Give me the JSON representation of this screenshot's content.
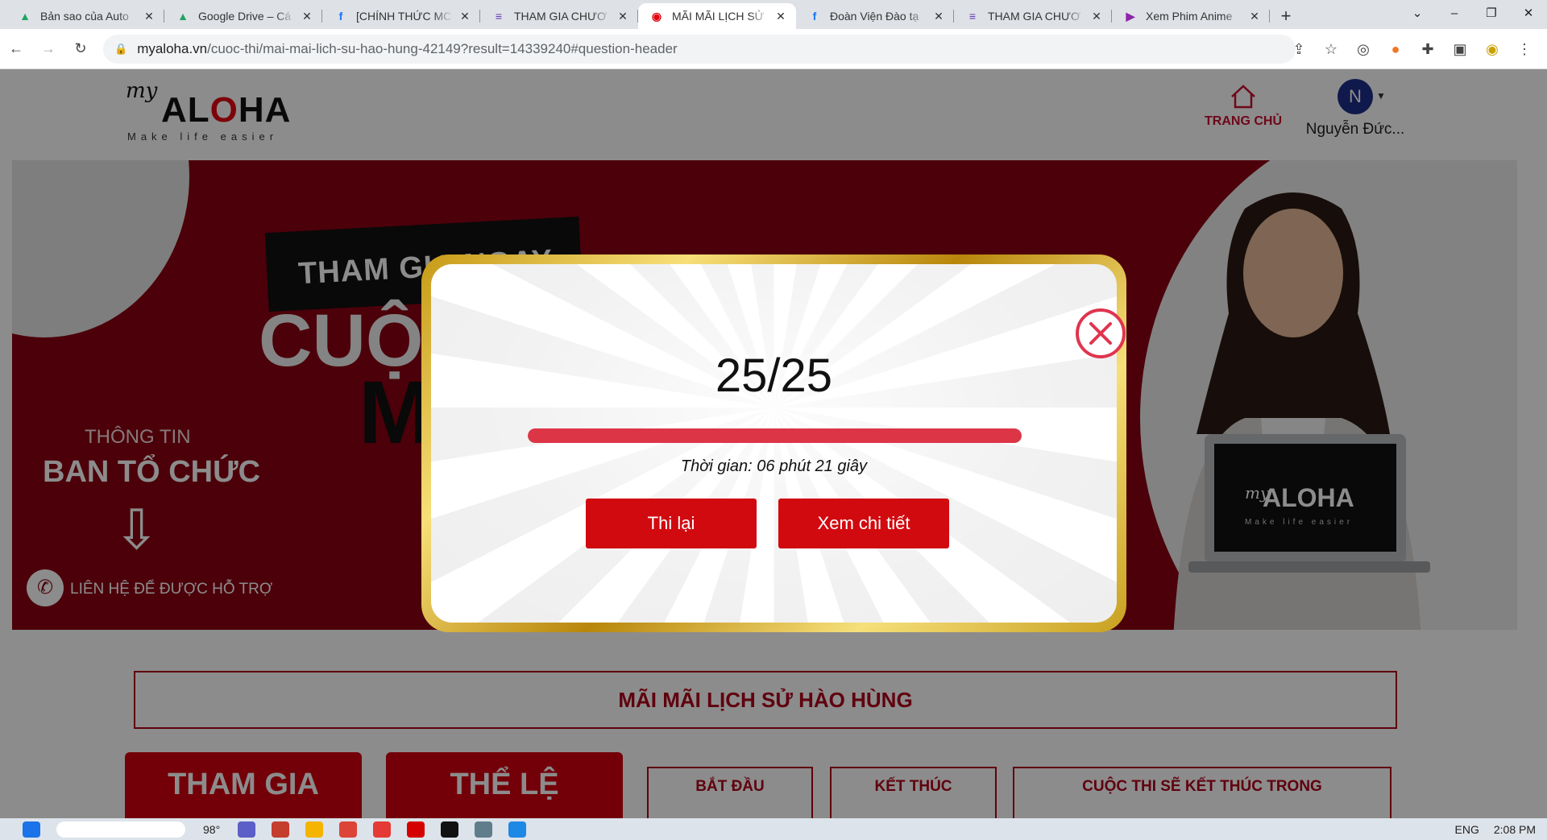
{
  "browser": {
    "tabs": [
      {
        "title": "Bản sao của Auto",
        "favicon": "google-drive-icon",
        "active": false
      },
      {
        "title": "Google Drive – Cá",
        "favicon": "google-drive-icon",
        "active": false
      },
      {
        "title": "[CHÍNH THỨC MC",
        "favicon": "facebook-icon",
        "active": false
      },
      {
        "title": "THAM GIA CHƯƠ",
        "favicon": "google-forms-icon",
        "active": false
      },
      {
        "title": "MÃI MÃI LỊCH SỬ",
        "favicon": "myaloha-icon",
        "active": true
      },
      {
        "title": "Đoàn Viện Đào tạ",
        "favicon": "facebook-icon",
        "active": false
      },
      {
        "title": "THAM GIA CHƯƠ",
        "favicon": "google-forms-icon",
        "active": false
      },
      {
        "title": "Xem Phim Anime",
        "favicon": "play-icon",
        "active": false
      }
    ],
    "url_host": "myaloha.vn",
    "url_path": "/cuoc-thi/mai-mai-lich-su-hao-hung-42149?result=14339240#question-header"
  },
  "header": {
    "logo_my": "my",
    "logo_brand_a": "AL",
    "logo_brand_o": "O",
    "logo_brand_b": "HA",
    "logo_tagline": "Make life easier",
    "home_label": "TRANG CHỦ",
    "avatar_initial": "N",
    "user_name": "Nguyễn Đức..."
  },
  "banner": {
    "join_text": "THAM GIA NGAY",
    "big_word": "CUỘC",
    "big_letter": "M",
    "info_line1": "THÔNG TIN",
    "info_line2": "BAN TỔ CHỨC",
    "support_text": "LIÊN HỆ ĐỂ ĐƯỢC HỖ TRỢ",
    "laptop_my": "my",
    "laptop_brand": "ALOHA",
    "laptop_tagline": "Make life easier"
  },
  "contest": {
    "title": "MÃI MÃI LỊCH SỬ HÀO HÙNG",
    "join_button": "THAM GIA",
    "rules_button": "THỂ LỆ",
    "start_label": "BẮT ĐẦU",
    "end_label": "KẾT THÚC",
    "countdown_label": "CUỘC THI SẼ KẾT THÚC TRONG"
  },
  "result_modal": {
    "score": "25/25",
    "progress_fraction": 1.0,
    "time_text": "Thời gian: 06 phút 21 giây",
    "retry_button": "Thi lại",
    "details_button": "Xem chi tiết"
  },
  "taskbar": {
    "weather": "98°",
    "language": "ENG",
    "clock": "2:08 PM"
  },
  "colors": {
    "brand_red": "#d10a10",
    "progress_red": "#dc3545",
    "banner_red": "#8a0011",
    "gold": "#e5c04a"
  }
}
